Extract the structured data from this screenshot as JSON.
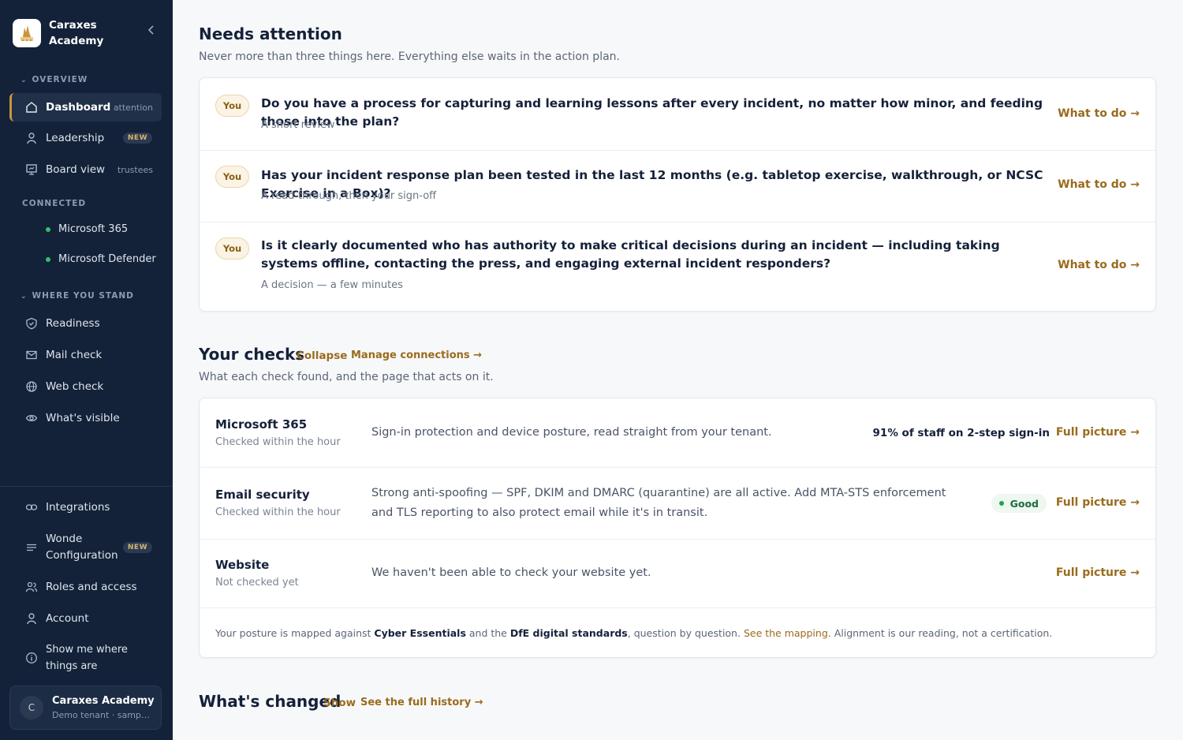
{
  "sidebar": {
    "brand": "Caraxes Academy",
    "overview_label": "OVERVIEW",
    "overview_items": [
      {
        "label": "Dashboard",
        "tag": "attention"
      },
      {
        "label": "Leadership",
        "badge": "NEW"
      },
      {
        "label": "Board view",
        "tag": "trustees"
      }
    ],
    "connected_label": "CONNECTED",
    "connected_items": [
      "Microsoft 365",
      "Microsoft Defender"
    ],
    "where_label": "WHERE YOU STAND",
    "where_items": [
      "Readiness",
      "Mail check",
      "Web check",
      "What's visible"
    ],
    "bottom_items": [
      {
        "label": "Integrations"
      },
      {
        "label": "Wonde Configuration",
        "badge": "NEW"
      },
      {
        "label": "Roles and access"
      },
      {
        "label": "Account"
      },
      {
        "label": "Show me where things are"
      }
    ],
    "tenant": {
      "initial": "C",
      "name": "Caraxes Academy",
      "sub": "Demo tenant · sample data"
    }
  },
  "attention": {
    "title": "Needs attention",
    "subtitle": "Never more than three things here. Everything else waits in the action plan.",
    "items": [
      {
        "owner": "You",
        "question": "Do you have a process for capturing and learning lessons after every incident, no matter how minor, and feeding those into the plan?",
        "hint": "A short review",
        "action": "What to do →"
      },
      {
        "owner": "You",
        "question": "Has your incident response plan been tested in the last 12 months (e.g. tabletop exercise, walkthrough, or NCSC Exercise in a Box)?",
        "hint": "A read-through, then your sign-off",
        "action": "What to do →"
      },
      {
        "owner": "You",
        "question": "Is it clearly documented who has authority to make critical decisions during an incident — including taking systems offline, contacting the press, and engaging external incident responders?",
        "hint": "A decision — a few minutes",
        "action": "What to do →"
      }
    ]
  },
  "checks": {
    "title": "Your checks",
    "collapse": "Collapse",
    "manage": "Manage connections →",
    "subtitle": "What each check found, and the page that acts on it.",
    "items": [
      {
        "name": "Microsoft 365",
        "when": "Checked within the hour",
        "desc": "Sign-in protection and device posture, read straight from your tenant.",
        "stat": "91% of staff on 2-step sign-in",
        "action": "Full picture →"
      },
      {
        "name": "Email security",
        "when": "Checked within the hour",
        "desc": "Strong anti-spoofing — SPF, DKIM and DMARC (quarantine) are all active. Add MTA-STS enforcement and TLS reporting to also protect email while it's in transit.",
        "status": "Good",
        "action": "Full picture →"
      },
      {
        "name": "Website",
        "when": "Not checked yet",
        "desc": "We haven't been able to check your website yet.",
        "action": "Full picture →"
      }
    ],
    "footnote": {
      "pre": "Your posture is mapped against ",
      "ce": "Cyber Essentials",
      "mid": " and the ",
      "dfe": "DfE digital standards",
      "post1": ", question by question. ",
      "link": "See the mapping",
      "post2": ". Alignment is our reading, not a certification."
    }
  },
  "changed": {
    "title": "What's changed",
    "show": "Show",
    "history": "See the full history →"
  },
  "colors": {
    "sidebar": "#132238",
    "accent": "#9a6b1c",
    "good": "#23a154"
  }
}
